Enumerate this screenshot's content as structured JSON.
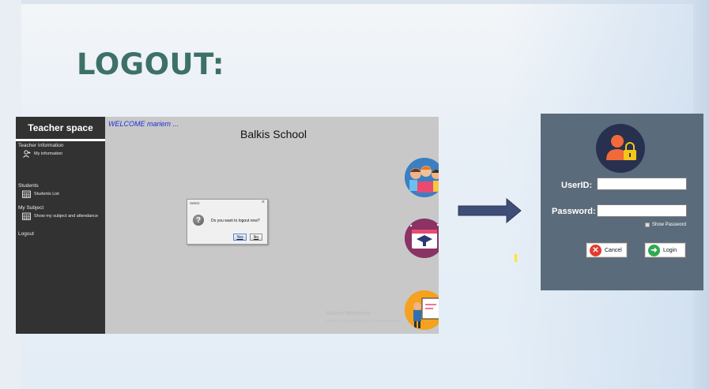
{
  "slide": {
    "title": "LOGOUT:"
  },
  "app": {
    "sidebar": {
      "header": "Teacher space",
      "sections": [
        {
          "label": "Teacher Information",
          "items": [
            {
              "label": "My information",
              "icon": "add-user-icon"
            }
          ]
        },
        {
          "label": "Students",
          "items": [
            {
              "label": "Students List",
              "icon": "calendar-grid-icon"
            }
          ]
        },
        {
          "label": "My Subject",
          "items": [
            {
              "label": "Show my subject and attendance",
              "icon": "calendar-grid-icon"
            }
          ]
        },
        {
          "label": "Logout",
          "items": []
        }
      ]
    },
    "welcome": "WELCOME mariem ...",
    "school_name": "Balkis School",
    "watermark": {
      "line1": "Activer Windows",
      "line2": "Accédez aux paramètres pour activer Windows."
    },
    "dialog": {
      "title": "Select",
      "close": "×",
      "icon": "question-icon",
      "message": "Do you want to logout now?",
      "yes_label": "Yes",
      "no_label": "No"
    }
  },
  "login": {
    "userid_label": "UserID:",
    "userid_value": "",
    "password_label": "Password:",
    "password_value": "",
    "show_password_label": "Show Password",
    "cancel_label": "Cancel",
    "login_label": "Login",
    "avatar_icon": "user-lock-icon"
  },
  "colors": {
    "title": "#3d7068",
    "sidebar": "#323232",
    "app_bg": "#c8c8c8",
    "welcome": "#1f2fd6",
    "login_panel": "#5a6b7b",
    "arrow": "#3f4e77"
  }
}
